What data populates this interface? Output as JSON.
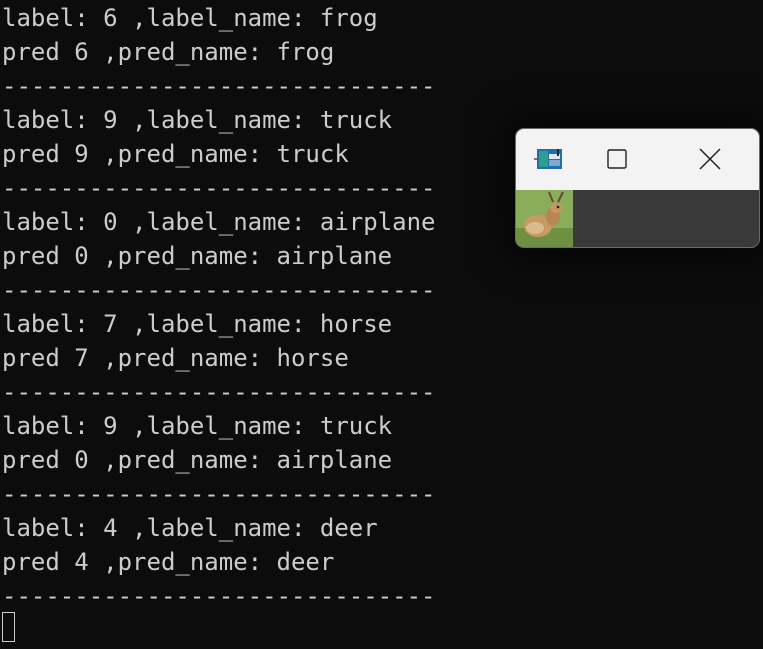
{
  "terminal": {
    "lines": [
      "label: 6 ,label_name: frog",
      "pred 6 ,pred_name: frog",
      "------------------------------",
      "label: 9 ,label_name: truck",
      "pred 9 ,pred_name: truck",
      "------------------------------",
      "label: 0 ,label_name: airplane",
      "pred 0 ,pred_name: airplane",
      "------------------------------",
      "label: 7 ,label_name: horse",
      "pred 7 ,pred_name: horse",
      "------------------------------",
      "label: 9 ,label_name: truck",
      "pred 0 ,pred_name: airplane",
      "------------------------------",
      "label: 4 ,label_name: deer",
      "pred 4 ,pred_name: deer",
      "------------------------------"
    ]
  },
  "popup": {
    "icons": {
      "app": "image-viewer-icon",
      "maximize": "maximize-icon",
      "close": "close-icon"
    },
    "image": "deer-thumbnail",
    "colors": {
      "titlebar": "#f3f3f3",
      "body": "#3a3a3a"
    }
  },
  "colors": {
    "background": "#0c0c0c",
    "text": "#cccccc"
  }
}
